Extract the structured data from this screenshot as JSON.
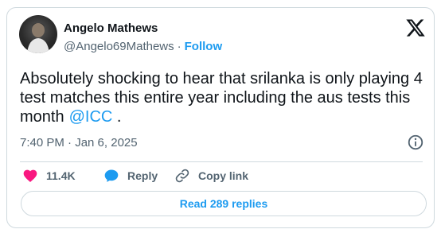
{
  "tweet": {
    "author_name": "Angelo Mathews",
    "handle": "@Angelo69Mathews",
    "separator": "·",
    "follow_label": "Follow",
    "text": "Absolutely shocking to hear that srilanka is only playing 4 test matches this entire year including the aus tests this month",
    "mention": "@ICC",
    "text_end": ".",
    "timestamp": "7:40 PM · Jan 6, 2025"
  },
  "actions": {
    "likes": "11.4K",
    "reply_label": "Reply",
    "copy_link_label": "Copy link"
  },
  "read_replies_label": "Read 289 replies",
  "icons": {
    "avatar": "profile-photo",
    "platform": "x-logo-icon",
    "info": "info-icon",
    "like": "heart-icon",
    "reply": "speech-bubble-icon",
    "copy": "link-icon"
  },
  "colors": {
    "accent": "#1d9bf0",
    "like": "#f91880",
    "text": "#0f1419",
    "muted": "#536471",
    "border": "#cfd9de"
  }
}
